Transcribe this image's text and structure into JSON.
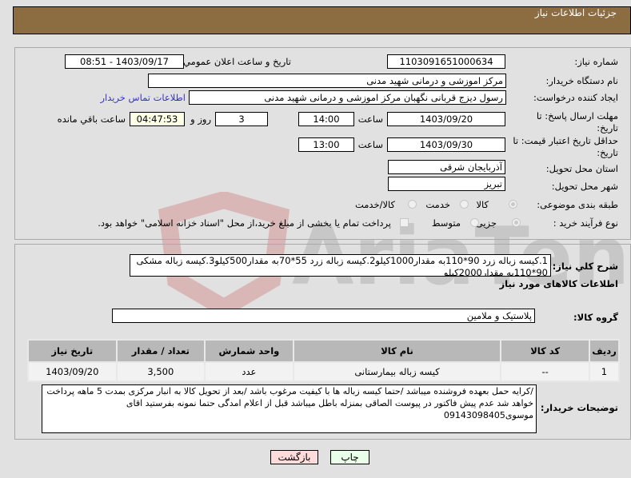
{
  "header": {
    "title": "جزئیات اطلاعات نیاز"
  },
  "fields": {
    "need_number": {
      "label": "شماره نیاز:",
      "value": "1103091651000634"
    },
    "announce_datetime": {
      "label": "تاريخ و ساعت اعلان عمومي:",
      "value": "1403/09/17 - 08:51"
    },
    "buyer_org": {
      "label": "نام دستگاه خریدار:",
      "value": "مرکز اموزشی و درمانی شهید مدنی"
    },
    "requester": {
      "label": "ایجاد کننده درخواست:",
      "value": "رسول دیزج قربانی نگهبان مرکز اموزشی و درمانی شهید مدنی"
    },
    "contact_link": "اطلاعات تماس خریدار",
    "response_deadline": {
      "label": "مهلت ارسال پاسخ: تا تاریخ:",
      "date": "1403/09/20",
      "time_label": "ساعت",
      "time": "14:00",
      "days": "3",
      "days_label": "روز و",
      "remaining": "04:47:53",
      "remaining_label": "ساعت باقي مانده"
    },
    "price_validity": {
      "label": "حداقل تاریخ اعتبار قیمت: تا تاریخ:",
      "date": "1403/09/30",
      "time_label": "ساعت",
      "time": "13:00"
    },
    "delivery_province": {
      "label": "استان محل تحویل:",
      "value": "آذربایجان شرقی"
    },
    "delivery_city": {
      "label": "شهر محل تحویل:",
      "value": "تبریز"
    },
    "category": {
      "label": "طبقه بندی موضوعی:",
      "options": [
        "کالا",
        "خدمت",
        "کالا/خدمت"
      ],
      "selected": "کالا"
    },
    "purchase_type": {
      "label": "نوع فرآیند خرید :",
      "options": [
        "جزیی",
        "متوسط"
      ],
      "selected": "جزیی",
      "treasury_checkbox_label": "پرداخت تمام یا بخشی از مبلغ خرید،از محل \"اسناد خزانه اسلامی\" خواهد بود.",
      "treasury_checked": false
    }
  },
  "description": {
    "label": "شرح کلي نياز:",
    "value": "1.کیسه زباله زرد 90*110به مقدار1000کیلو2.کیسه زباله زرد 55*70به مقدار500کیلو3.کیسه زباله مشکی 90*110به مقدار2000کیلو"
  },
  "goods_section_title": "اطلاعات کالاهای مورد نیاز",
  "goods_group": {
    "label": "گروه کالا:",
    "value": "پلاستیک و ملامین"
  },
  "items_table": {
    "headers": [
      "ردیف",
      "کد کالا",
      "نام کالا",
      "واحد شمارش",
      "تعداد / مقدار",
      "تاریخ نیاز"
    ],
    "rows": [
      [
        "1",
        "--",
        "کیسه زباله بیمارستانی",
        "عدد",
        "3,500",
        "1403/09/20"
      ]
    ]
  },
  "buyer_notes": {
    "label": "توضیحات خریدار:",
    "value": "/کرایه حمل بعهده فروشنده میباشد /حتما کیسه زباله ها با کیفیت مرغوب باشد /بعد از تحویل کالا به انبار مرکزی بمدت 5 ماهه پرداخت خواهد شد عدم پیش فاکتور در پیوست الصاقی بمنزله باطل میباشد قبل از اعلام امدگی حتما نمونه بفرستید اقای موسوی09143098405"
  },
  "buttons": {
    "print": "چاپ",
    "back": "بازگشت"
  },
  "colors": {
    "header_bg": "#8c6c41",
    "print_bg": "#eaffea",
    "back_bg": "#ffdcdc",
    "remaining_bg": "#ffffe6",
    "link": "#3333cc"
  }
}
